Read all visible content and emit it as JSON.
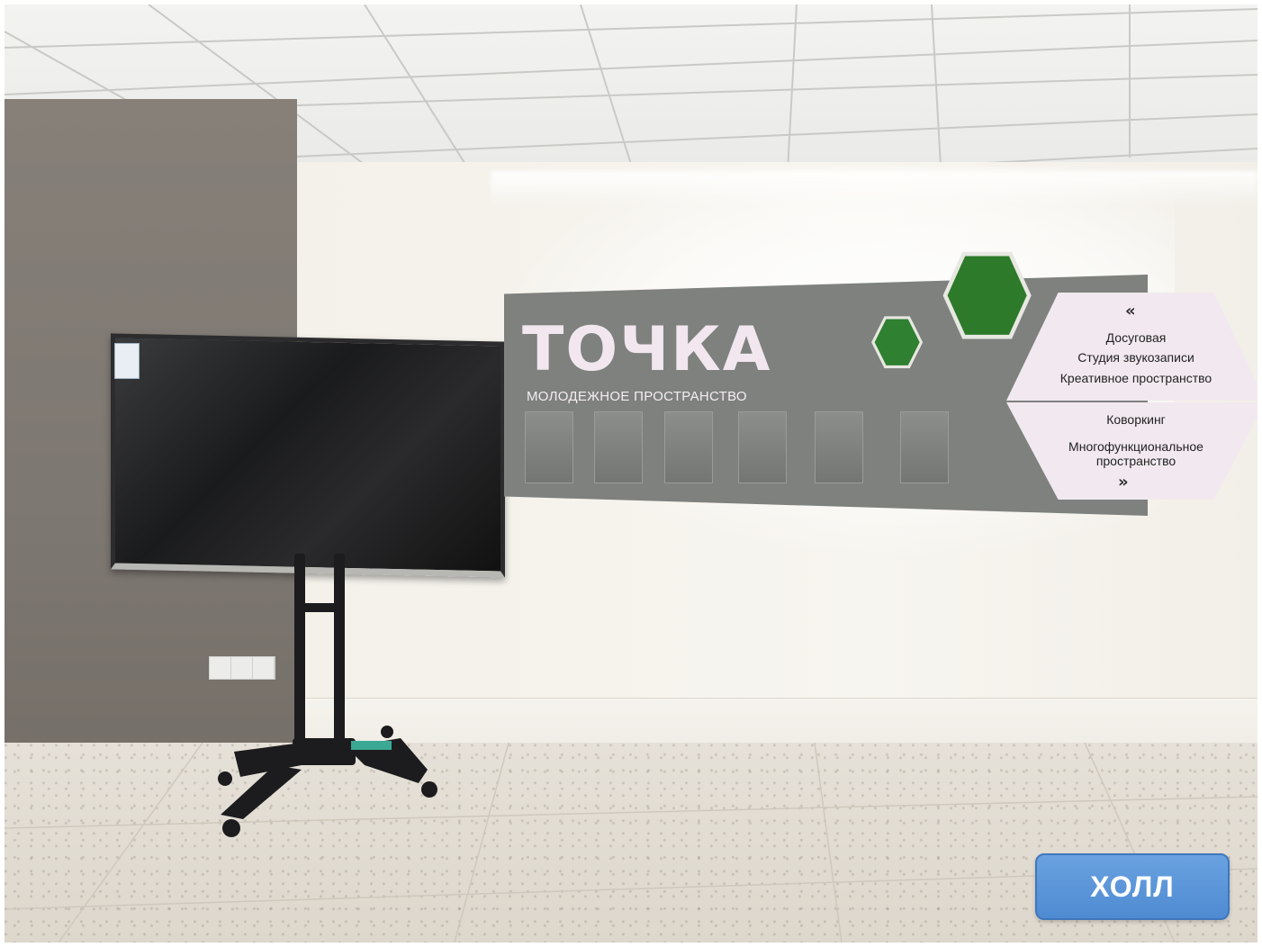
{
  "sign": {
    "brand": "ТОЧКА",
    "subtitle": "МОЛОДЕЖНОЕ ПРОСТРАНСТВО",
    "nav_up": [
      "Досуговая",
      "Студия звукозаписи",
      "Креативное пространство"
    ],
    "nav_down": [
      "Коворкинг",
      "Многофункциональное",
      "пространство"
    ]
  },
  "overlay": {
    "button_label": "ХОЛЛ"
  },
  "colors": {
    "button": "#5a95d8",
    "sign_panel": "#7e817e",
    "sign_text": "#f2e7ee",
    "moss": "#2f7a2c"
  }
}
